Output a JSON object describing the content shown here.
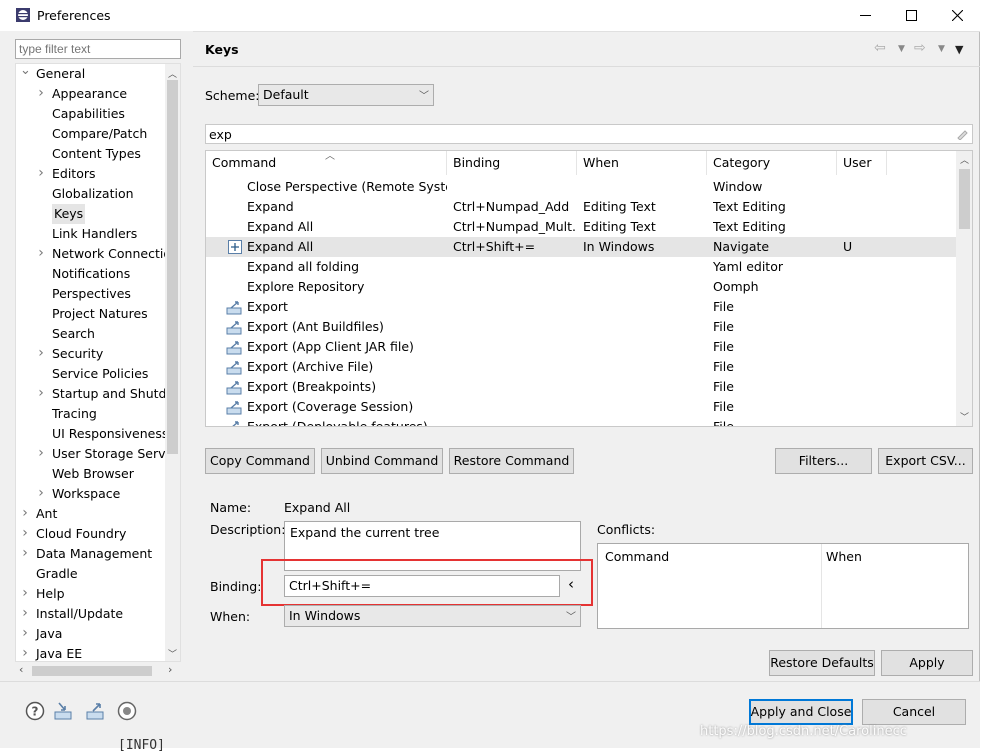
{
  "window": {
    "title": "Preferences",
    "minimize_glyph": "—",
    "maximize_glyph": "☐",
    "close_glyph": "✕"
  },
  "sidebar": {
    "filter_placeholder": "type filter text",
    "items": [
      {
        "label": "General",
        "level": 0,
        "twisty": "v"
      },
      {
        "label": "Appearance",
        "level": 1,
        "twisty": ">"
      },
      {
        "label": "Capabilities",
        "level": 1,
        "twisty": ""
      },
      {
        "label": "Compare/Patch",
        "level": 1,
        "twisty": ""
      },
      {
        "label": "Content Types",
        "level": 1,
        "twisty": ""
      },
      {
        "label": "Editors",
        "level": 1,
        "twisty": ">"
      },
      {
        "label": "Globalization",
        "level": 1,
        "twisty": ""
      },
      {
        "label": "Keys",
        "level": 1,
        "twisty": "",
        "selected": true
      },
      {
        "label": "Link Handlers",
        "level": 1,
        "twisty": ""
      },
      {
        "label": "Network Connectio",
        "level": 1,
        "twisty": ">"
      },
      {
        "label": "Notifications",
        "level": 1,
        "twisty": ""
      },
      {
        "label": "Perspectives",
        "level": 1,
        "twisty": ""
      },
      {
        "label": "Project Natures",
        "level": 1,
        "twisty": ""
      },
      {
        "label": "Search",
        "level": 1,
        "twisty": ""
      },
      {
        "label": "Security",
        "level": 1,
        "twisty": ">"
      },
      {
        "label": "Service Policies",
        "level": 1,
        "twisty": ""
      },
      {
        "label": "Startup and Shutdo",
        "level": 1,
        "twisty": ">"
      },
      {
        "label": "Tracing",
        "level": 1,
        "twisty": ""
      },
      {
        "label": "UI Responsiveness",
        "level": 1,
        "twisty": ""
      },
      {
        "label": "User Storage Servic",
        "level": 1,
        "twisty": ">"
      },
      {
        "label": "Web Browser",
        "level": 1,
        "twisty": ""
      },
      {
        "label": "Workspace",
        "level": 1,
        "twisty": ">"
      },
      {
        "label": "Ant",
        "level": 0,
        "twisty": ">"
      },
      {
        "label": "Cloud Foundry",
        "level": 0,
        "twisty": ">"
      },
      {
        "label": "Data Management",
        "level": 0,
        "twisty": ">"
      },
      {
        "label": "Gradle",
        "level": 0,
        "twisty": ""
      },
      {
        "label": "Help",
        "level": 0,
        "twisty": ">"
      },
      {
        "label": "Install/Update",
        "level": 0,
        "twisty": ">"
      },
      {
        "label": "Java",
        "level": 0,
        "twisty": ">"
      },
      {
        "label": "Java EE",
        "level": 0,
        "twisty": ">"
      }
    ]
  },
  "page": {
    "title": "Keys",
    "nav_back": "⇦",
    "nav_forward": "⇨",
    "menu": "▾"
  },
  "scheme": {
    "label": "Scheme:",
    "value": "Default"
  },
  "search": {
    "value": "exp"
  },
  "table": {
    "columns": [
      "Command",
      "Binding",
      "When",
      "Category",
      "User"
    ],
    "rows": [
      {
        "icon": "",
        "command": "Close Perspective (Remote System",
        "binding": "",
        "when": "",
        "category": "Window",
        "user": ""
      },
      {
        "icon": "",
        "command": "Expand",
        "binding": "Ctrl+Numpad_Add",
        "when": "Editing Text",
        "category": "Text Editing",
        "user": ""
      },
      {
        "icon": "",
        "command": "Expand All",
        "binding": "Ctrl+Numpad_Mult...",
        "when": "Editing Text",
        "category": "Text Editing",
        "user": ""
      },
      {
        "icon": "expand-all-icon",
        "command": "Expand All",
        "binding": "Ctrl+Shift+=",
        "when": "In Windows",
        "category": "Navigate",
        "user": "U",
        "selected": true
      },
      {
        "icon": "",
        "command": "Expand all folding",
        "binding": "",
        "when": "",
        "category": "Yaml editor",
        "user": ""
      },
      {
        "icon": "",
        "command": "Explore Repository",
        "binding": "",
        "when": "",
        "category": "Oomph",
        "user": ""
      },
      {
        "icon": "export-icon",
        "command": "Export",
        "binding": "",
        "when": "",
        "category": "File",
        "user": ""
      },
      {
        "icon": "export-icon",
        "command": "Export (Ant Buildfiles)",
        "binding": "",
        "when": "",
        "category": "File",
        "user": ""
      },
      {
        "icon": "export-icon",
        "command": "Export (App Client JAR file)",
        "binding": "",
        "when": "",
        "category": "File",
        "user": ""
      },
      {
        "icon": "export-icon",
        "command": "Export (Archive File)",
        "binding": "",
        "when": "",
        "category": "File",
        "user": ""
      },
      {
        "icon": "export-icon",
        "command": "Export (Breakpoints)",
        "binding": "",
        "when": "",
        "category": "File",
        "user": ""
      },
      {
        "icon": "export-icon",
        "command": "Export (Coverage Session)",
        "binding": "",
        "when": "",
        "category": "File",
        "user": ""
      },
      {
        "icon": "export-icon",
        "command": "Export (Deployable features)",
        "binding": "",
        "when": "",
        "category": "File",
        "user": ""
      }
    ]
  },
  "buttons": {
    "copy_command": "Copy Command",
    "unbind_command": "Unbind Command",
    "restore_command": "Restore Command",
    "filters": "Filters...",
    "export_csv": "Export CSV...",
    "restore_defaults": "Restore Defaults",
    "apply": "Apply",
    "apply_and_close": "Apply and Close",
    "cancel": "Cancel"
  },
  "details": {
    "name_label": "Name:",
    "name_value": "Expand All",
    "description_label": "Description:",
    "description_value": "Expand the current tree",
    "binding_label": "Binding:",
    "binding_value": "Ctrl+Shift+=",
    "binding_arrow": "‹",
    "when_label": "When:",
    "when_value": "In Windows"
  },
  "conflicts": {
    "label": "Conflicts:",
    "columns": [
      "Command",
      "When"
    ]
  },
  "watermark": "https://blog.csdn.net/Carolinecc",
  "outside_text": "[INFO]",
  "colors": {
    "highlight_box": "#e53333",
    "selected_row": "#e5e5e5",
    "default_button_border": "#0078d7"
  }
}
